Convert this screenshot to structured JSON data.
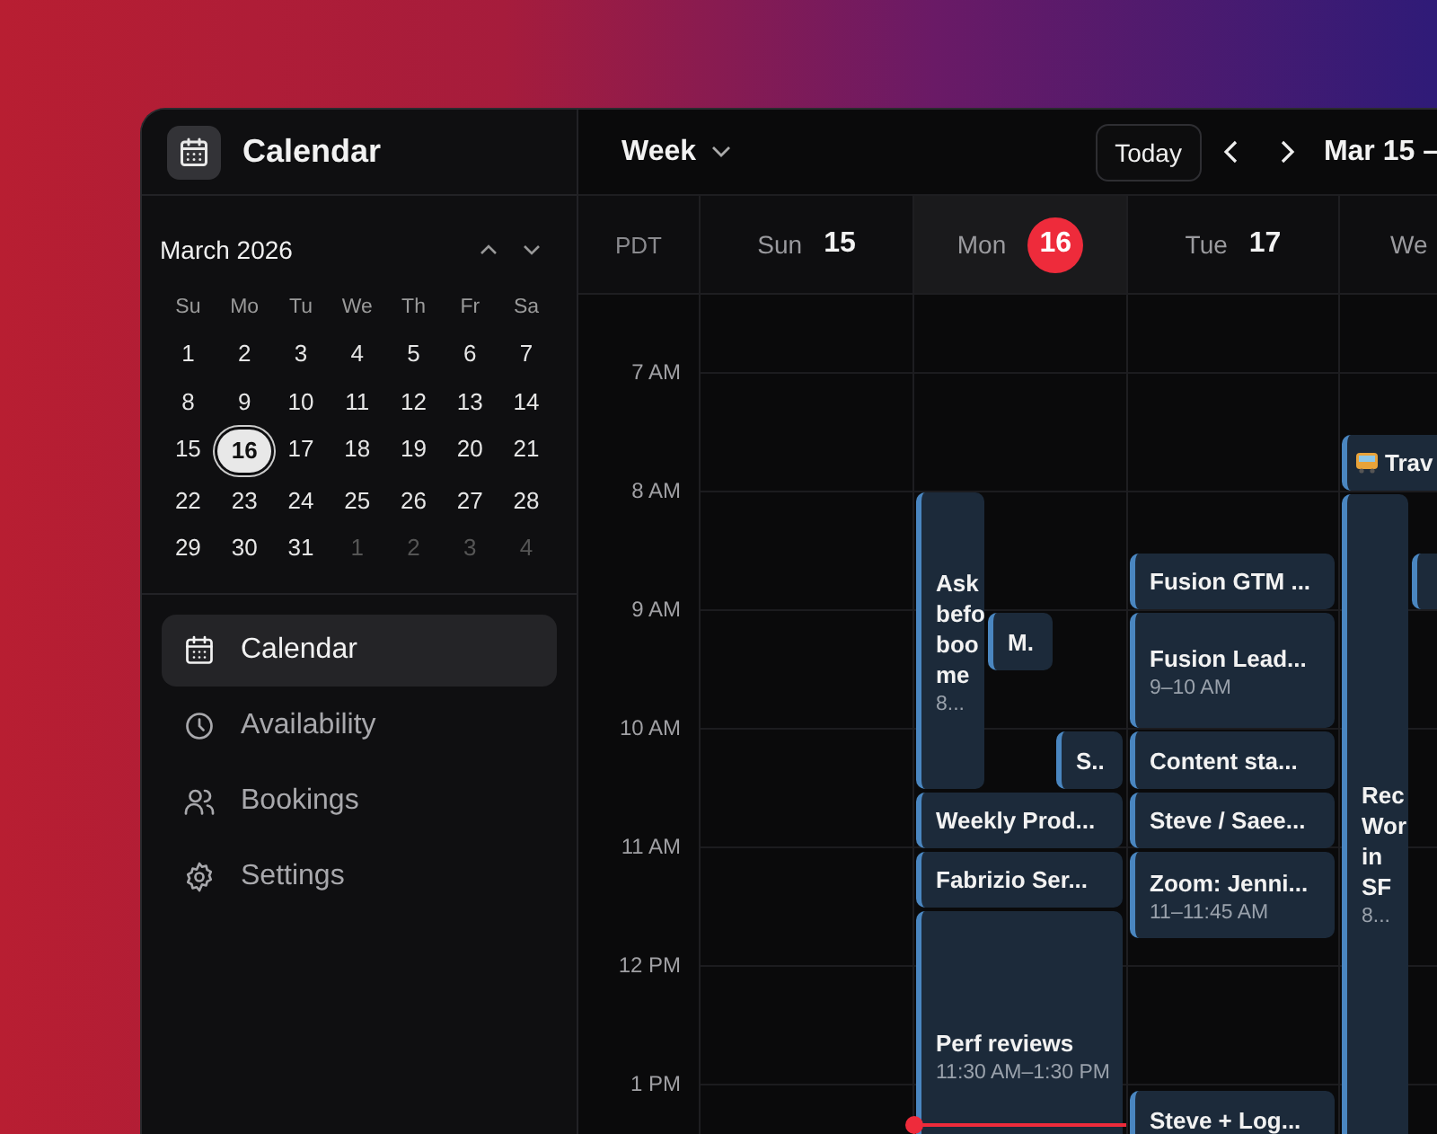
{
  "sidebar": {
    "app_title": "Calendar",
    "mini_calendar": {
      "month": "March 2026",
      "weekdays": [
        "Su",
        "Mo",
        "Tu",
        "We",
        "Th",
        "Fr",
        "Sa"
      ],
      "weeks": [
        [
          {
            "label": "1",
            "muted": false,
            "selected": false
          },
          {
            "label": "2",
            "muted": false,
            "selected": false
          },
          {
            "label": "3",
            "muted": false,
            "selected": false
          },
          {
            "label": "4",
            "muted": false,
            "selected": false
          },
          {
            "label": "5",
            "muted": false,
            "selected": false
          },
          {
            "label": "6",
            "muted": false,
            "selected": false
          },
          {
            "label": "7",
            "muted": false,
            "selected": false
          }
        ],
        [
          {
            "label": "8",
            "muted": false,
            "selected": false
          },
          {
            "label": "9",
            "muted": false,
            "selected": false
          },
          {
            "label": "10",
            "muted": false,
            "selected": false
          },
          {
            "label": "11",
            "muted": false,
            "selected": false
          },
          {
            "label": "12",
            "muted": false,
            "selected": false
          },
          {
            "label": "13",
            "muted": false,
            "selected": false
          },
          {
            "label": "14",
            "muted": false,
            "selected": false
          }
        ],
        [
          {
            "label": "15",
            "muted": false,
            "selected": false
          },
          {
            "label": "16",
            "muted": false,
            "selected": true
          },
          {
            "label": "17",
            "muted": false,
            "selected": false
          },
          {
            "label": "18",
            "muted": false,
            "selected": false
          },
          {
            "label": "19",
            "muted": false,
            "selected": false
          },
          {
            "label": "20",
            "muted": false,
            "selected": false
          },
          {
            "label": "21",
            "muted": false,
            "selected": false
          }
        ],
        [
          {
            "label": "22",
            "muted": false,
            "selected": false
          },
          {
            "label": "23",
            "muted": false,
            "selected": false
          },
          {
            "label": "24",
            "muted": false,
            "selected": false
          },
          {
            "label": "25",
            "muted": false,
            "selected": false
          },
          {
            "label": "26",
            "muted": false,
            "selected": false
          },
          {
            "label": "27",
            "muted": false,
            "selected": false
          },
          {
            "label": "28",
            "muted": false,
            "selected": false
          }
        ],
        [
          {
            "label": "29",
            "muted": false,
            "selected": false
          },
          {
            "label": "30",
            "muted": false,
            "selected": false
          },
          {
            "label": "31",
            "muted": false,
            "selected": false
          },
          {
            "label": "1",
            "muted": true,
            "selected": false
          },
          {
            "label": "2",
            "muted": true,
            "selected": false
          },
          {
            "label": "3",
            "muted": true,
            "selected": false
          },
          {
            "label": "4",
            "muted": true,
            "selected": false
          }
        ]
      ]
    },
    "nav": [
      {
        "label": "Calendar",
        "kind": "calendar",
        "selected": true
      },
      {
        "label": "Availability",
        "kind": "clock",
        "selected": false
      },
      {
        "label": "Bookings",
        "kind": "people",
        "selected": false
      },
      {
        "label": "Settings",
        "kind": "gear",
        "selected": false
      }
    ]
  },
  "toolbar": {
    "view": "Week",
    "today_button": "Today",
    "range": "Mar 15 –"
  },
  "timezone": "PDT",
  "hours": [
    "7 AM",
    "8 AM",
    "9 AM",
    "10 AM",
    "11 AM",
    "12 PM",
    "1 PM"
  ],
  "days": [
    {
      "weekday": "Sun",
      "date": "15",
      "selected": false,
      "now": false
    },
    {
      "weekday": "Mon",
      "date": "16",
      "selected": true,
      "now": true,
      "events": [
        {
          "kind": "event",
          "title": "Ask befo boo me",
          "time": "8..."
        },
        {
          "kind": "event",
          "title": "M."
        },
        {
          "kind": "event",
          "title": "S.."
        },
        {
          "kind": "event",
          "title": "Weekly Prod..."
        },
        {
          "kind": "event",
          "title": "Fabrizio Ser..."
        },
        {
          "kind": "event",
          "title": "Perf reviews",
          "time": "11:30 AM–1:30 PM"
        }
      ]
    },
    {
      "weekday": "Tue",
      "date": "17",
      "selected": false,
      "now": false,
      "events": [
        {
          "kind": "event",
          "title": "Fusion GTM ..."
        },
        {
          "kind": "event",
          "title": "Fusion Lead...",
          "time": "9–10 AM"
        },
        {
          "kind": "event",
          "title": "Content sta..."
        },
        {
          "kind": "event",
          "title": "Steve / Saee..."
        },
        {
          "kind": "event",
          "title": "Zoom: Jenni...",
          "time": "11–11:45 AM"
        },
        {
          "kind": "event",
          "title": "Steve + Log..."
        }
      ]
    },
    {
      "weekday": "We",
      "selected": false,
      "now": false,
      "events": [
        {
          "kind": "travel",
          "title": "Trav"
        },
        {
          "kind": "event",
          "title": "Rec Wor in SF",
          "time": "8..."
        },
        {
          "kind": "event"
        }
      ]
    }
  ]
}
